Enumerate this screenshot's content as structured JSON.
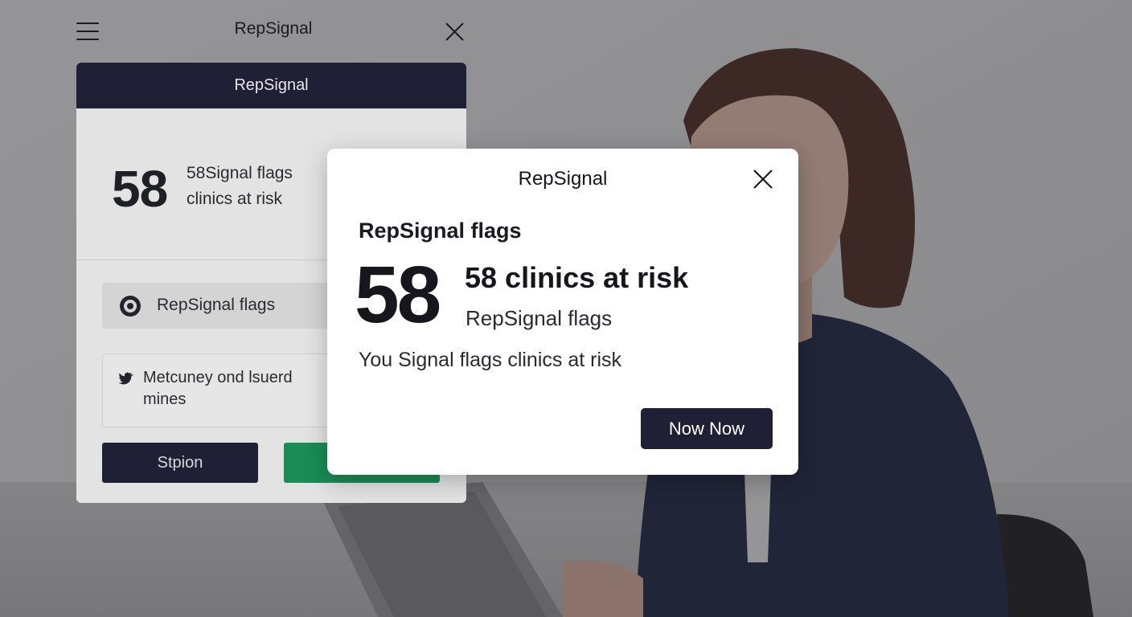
{
  "background_app": {
    "title": "RepSignal",
    "panel_header": "RepSignal",
    "stat_number": "58",
    "stat_text_line1": "58Signal flags",
    "stat_text_line2": "clinics at risk",
    "row_label": "RepSignal flags",
    "card_text": "Metcuney ond lsuerd mines",
    "primary_button": "Stpion",
    "secondary_button": ""
  },
  "modal": {
    "title": "RepSignal",
    "heading": "RepSignal flags",
    "number": "58",
    "stat_title": "58 clinics at risk",
    "stat_subtitle": "RepSignal flags",
    "description": "You Signal flags clinics at risk",
    "button_label": "Now Now"
  },
  "colors": {
    "navy": "#1f2036",
    "green": "#1a8c55",
    "modal_bg": "#ffffff"
  },
  "icons": [
    "menu-icon",
    "close-icon",
    "target-icon",
    "bird-icon"
  ]
}
